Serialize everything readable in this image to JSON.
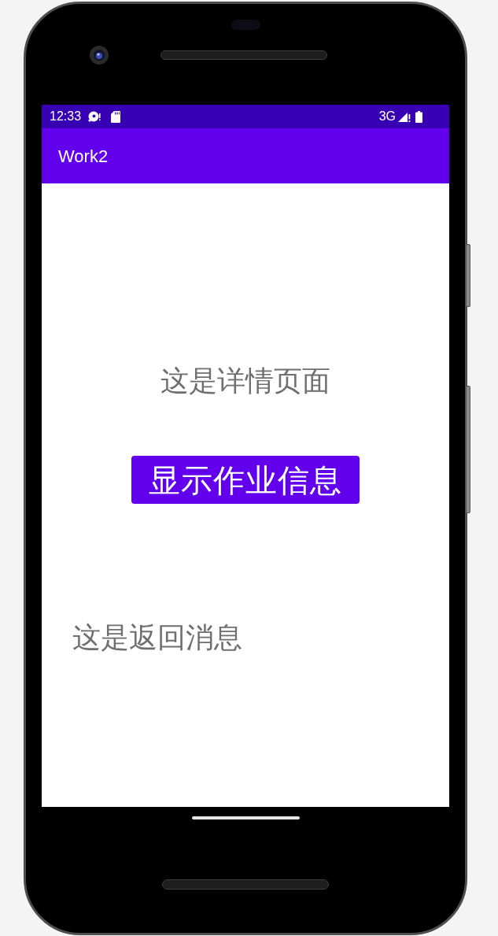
{
  "status_bar": {
    "time": "12:33",
    "network": "3G"
  },
  "app_bar": {
    "title": "Work2"
  },
  "content": {
    "heading": "这是详情页面",
    "button": "显示作业信息",
    "message": "这是返回消息"
  }
}
